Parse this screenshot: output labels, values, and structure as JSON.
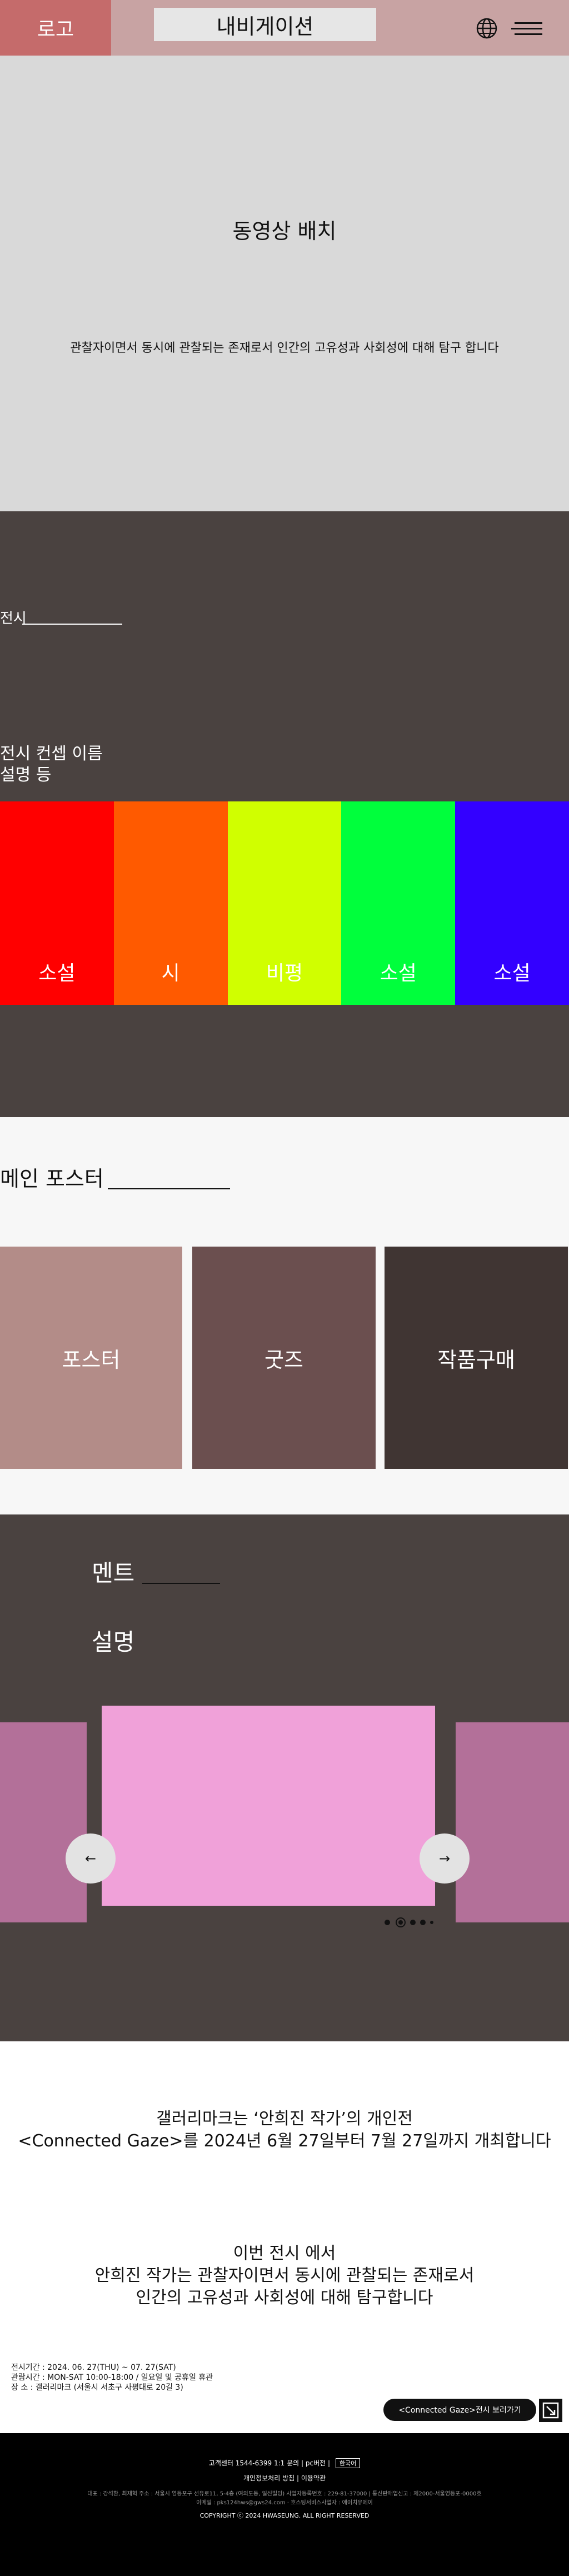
{
  "header": {
    "logo": "로고",
    "nav": "내비게이션",
    "globe_icon": "globe-icon",
    "menu_icon": "hamburger-menu-icon"
  },
  "hero": {
    "title": "동영상 배치",
    "subtitle": "관찰자이면서 동시에 관찰되는 존재로서 인간의 고유성과 사회성에 대해 탐구 합니다"
  },
  "exhibition": {
    "label": "전시",
    "concept_name": "전시 컨셉 이름",
    "description": "설명 등",
    "items": [
      {
        "label": "소설",
        "color": "#ff0000"
      },
      {
        "label": "시",
        "color": "#ff5a00"
      },
      {
        "label": "비평",
        "color": "#d0ff00"
      },
      {
        "label": "소설",
        "color": "#00ff3c"
      },
      {
        "label": "소설",
        "color": "#3300ff"
      }
    ]
  },
  "main_poster": {
    "title": "메인 포스터",
    "cards": [
      {
        "label": "포스터",
        "color": "#b38c88"
      },
      {
        "label": "굿즈",
        "color": "#6b4f4f"
      },
      {
        "label": "작품구매",
        "color": "#403533"
      }
    ]
  },
  "ment": {
    "title": "멘트",
    "description": "설명",
    "prev_icon": "arrow-left-icon",
    "next_icon": "arrow-right-icon",
    "prev_glyph": "←",
    "next_glyph": "→",
    "slide_count": 5,
    "active_slide": 2
  },
  "about": {
    "p1_line1": "갤러리마크는 ‘안희진 작가’의 개인전",
    "p1_line2": "<Connected Gaze>를 2024년 6월 27일부터 7월 27일까지 개최합니다",
    "p2_line1": "이번 전시 에서",
    "p2_line2": "안희진 작가는 관찰자이면서 동시에 관찰되는 존재로서",
    "p2_line3": "인간의 고유성과 사회성에 대해 탐구합니다",
    "info_period": "전시기간 : 2024. 06. 27(THU) ~ 07. 27(SAT)",
    "info_hours": "관람시간 : MON-SAT 10:00-18:00 / 일요일 및 공휴일 휴관",
    "info_place": "장 소 : 갤러리마크 (서울시 서초구 사평대로 20길 3)",
    "pill_label": "<Connected Gaze>전시 보러가기",
    "external_icon": "external-link-icon"
  },
  "footer": {
    "line1": "고객센터 1544-6399 1:1 문의 | pc버전 |",
    "lang_button": "한국어",
    "line2": "개인정보처리 방침 | 이용약관",
    "line3": "대표 : 강석환, 최재혁 주소 : 서울시 영등포구 선유로11, 5-4층 (여의도동, 일신빌딩) 사업자등록번호 : 229-81-37000 | 통신판매업신고 : 제2000-서울영등포-0000호",
    "line4": "이메일 : pks124hws@gws24.com  ·  호스팅서비스사업자 : 에이치유에이",
    "copyright": "COPYRIGHT ⓒ 2024 HWASEUNG. ALL RIGHT RESERVED"
  }
}
